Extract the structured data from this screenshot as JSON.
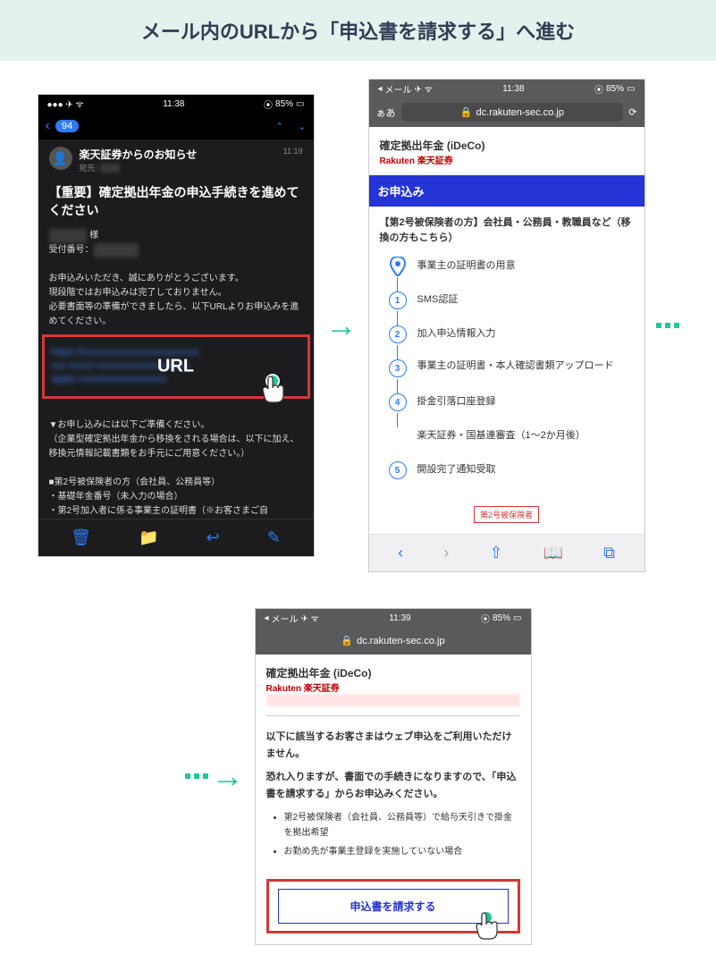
{
  "banner_title": "メール内のURLから「申込書を請求する」へ進む",
  "status": {
    "time": "11:38",
    "battery": "85%",
    "carrier": "メール"
  },
  "status2_time": "11:39",
  "mail": {
    "badge": "94",
    "sender": "楽天証券からのお知らせ",
    "addressee": "宛先:",
    "time": "11:19",
    "subject": "【重要】確定拠出年金の申込手続きを進めてください",
    "honor": "様",
    "ref": "受付番号：",
    "p1": "お申込みいただき、誠にありがとうございます。",
    "p2": "現段階ではお申込みは完了しておりません。",
    "p3": "必要書面等の準備ができましたら、以下URLよりお申込みを進めてください。",
    "url_label": "URL",
    "prep_head": "▼お申し込みには以下ご準備ください。",
    "prep_note": "（企業型確定拠出年金から移換をされる場合は、以下に加え、移換元情報記載書類をお手元にご用意ください。）",
    "sec2_head": "■第2号被保険者の方（会社員、公務員等）",
    "sec2_b1": "・基礎年金番号（未入力の場合）",
    "sec2_b2": "・第2号加入者に係る事業主の証明書（※お客さまご自"
  },
  "web": {
    "domain": "dc.rakuten-sec.co.jp",
    "aa": "ぁあ",
    "page_title": "確定拠出年金 (iDeCo)",
    "brand": "Rakuten 楽天証券",
    "blue_header": "お申込み",
    "category_title": "【第2号被保険者の方】会社員・公務員・教職員など（移換の方もこちら）",
    "step0": "事業主の証明書の用意",
    "step1": "SMS認証",
    "step2": "加入申込情報入力",
    "step3": "事業主の証明書・本人確認書類アップロード",
    "step4": "掛金引落口座登録",
    "step4b": "楽天証券・国基連審査（1～2か月後）",
    "step5": "開設完了通知受取",
    "tag": "第2号被保険者"
  },
  "web2": {
    "note_title": "以下に該当するお客さまはウェブ申込をご利用いただけません。",
    "note_body": "恐れ入りますが、書面での手続きになりますので、「申込書を請求する」からお申込みください。",
    "bullet1": "第2号被保険者（会社員、公務員等）で給与天引きで掛金を拠出希望",
    "bullet2": "お勤め先が事業主登録を実施していない場合",
    "button": "申込書を請求する"
  }
}
